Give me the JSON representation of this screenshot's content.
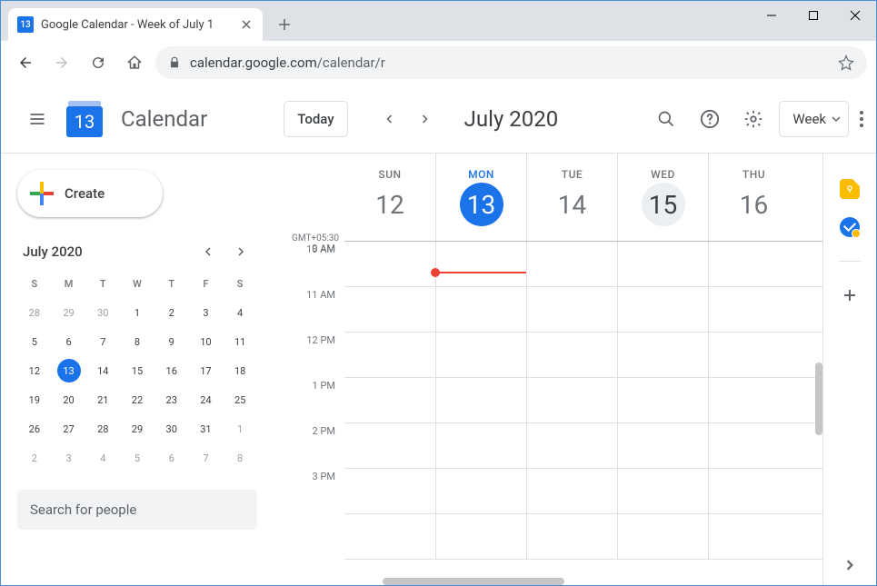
{
  "browser": {
    "tab_title": "Google Calendar - Week of July 1",
    "favicon_text": "13",
    "url_host": "calendar.google.com",
    "url_path": "/calendar/r"
  },
  "header": {
    "logo_day": "13",
    "app_title": "Calendar",
    "today_label": "Today",
    "period_label": "July 2020",
    "view_label": "Week"
  },
  "sidebar": {
    "create_label": "Create",
    "minical_title": "July 2020",
    "dow": [
      "S",
      "M",
      "T",
      "W",
      "T",
      "F",
      "S"
    ],
    "weeks": [
      [
        {
          "n": "28",
          "dim": true
        },
        {
          "n": "29",
          "dim": true
        },
        {
          "n": "30",
          "dim": true
        },
        {
          "n": "1"
        },
        {
          "n": "2"
        },
        {
          "n": "3"
        },
        {
          "n": "4"
        }
      ],
      [
        {
          "n": "5"
        },
        {
          "n": "6"
        },
        {
          "n": "7"
        },
        {
          "n": "8"
        },
        {
          "n": "9"
        },
        {
          "n": "10"
        },
        {
          "n": "11"
        }
      ],
      [
        {
          "n": "12"
        },
        {
          "n": "13",
          "today": true
        },
        {
          "n": "14"
        },
        {
          "n": "15"
        },
        {
          "n": "16"
        },
        {
          "n": "17"
        },
        {
          "n": "18"
        }
      ],
      [
        {
          "n": "19"
        },
        {
          "n": "20"
        },
        {
          "n": "21"
        },
        {
          "n": "22"
        },
        {
          "n": "23"
        },
        {
          "n": "24"
        },
        {
          "n": "25"
        }
      ],
      [
        {
          "n": "26"
        },
        {
          "n": "27"
        },
        {
          "n": "28"
        },
        {
          "n": "29"
        },
        {
          "n": "30"
        },
        {
          "n": "31"
        },
        {
          "n": "1",
          "dim": true
        }
      ],
      [
        {
          "n": "2",
          "dim": true
        },
        {
          "n": "3",
          "dim": true
        },
        {
          "n": "4",
          "dim": true
        },
        {
          "n": "5",
          "dim": true
        },
        {
          "n": "6",
          "dim": true
        },
        {
          "n": "7",
          "dim": true
        },
        {
          "n": "8",
          "dim": true
        }
      ]
    ],
    "search_placeholder": "Search for people"
  },
  "grid": {
    "timezone": "GMT+05:30",
    "first_label": "9 AM",
    "times": [
      "10 AM",
      "11 AM",
      "12 PM",
      "1 PM",
      "2 PM",
      "3 PM"
    ],
    "days": [
      {
        "dow": "SUN",
        "num": "12"
      },
      {
        "dow": "MON",
        "num": "13",
        "today": true
      },
      {
        "dow": "TUE",
        "num": "14"
      },
      {
        "dow": "WED",
        "num": "15",
        "hover": true
      },
      {
        "dow": "THU",
        "num": "16"
      }
    ]
  }
}
